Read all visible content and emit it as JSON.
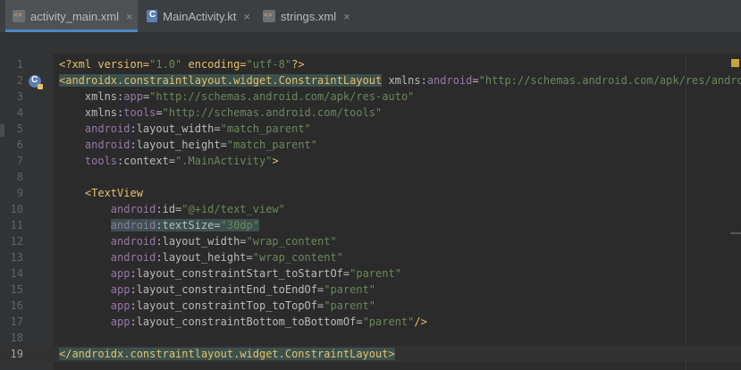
{
  "tabs": [
    {
      "label": "activity_main.xml",
      "icon": "xml-file-icon",
      "active": true
    },
    {
      "label": "MainActivity.kt",
      "icon": "kotlin-class-icon",
      "active": false
    },
    {
      "label": "strings.xml",
      "icon": "xml-file-icon",
      "active": false
    }
  ],
  "close_glyph": "×",
  "line_numbers": [
    "1",
    "2",
    "3",
    "4",
    "5",
    "6",
    "7",
    "8",
    "9",
    "10",
    "11",
    "12",
    "13",
    "14",
    "15",
    "16",
    "17",
    "18",
    "19"
  ],
  "code": {
    "l1": {
      "decl": "<?xml version=",
      "v1": "\"1.0\"",
      "enc": " encoding=",
      "v2": "\"utf-8\"",
      "end": "?>"
    },
    "l2": {
      "open": "<androidx.constraintlayout.widget.ConstraintLayout",
      "xmlns": " xmlns:",
      "ns": "android",
      "eq": "=",
      "val": "\"http://schemas.android.com/apk/res/android\""
    },
    "l3": {
      "indent": "    ",
      "xmlns": "xmlns:",
      "ns": "app",
      "eq": "=",
      "val": "\"http://schemas.android.com/apk/res-auto\""
    },
    "l4": {
      "indent": "    ",
      "xmlns": "xmlns:",
      "ns": "tools",
      "eq": "=",
      "val": "\"http://schemas.android.com/tools\""
    },
    "l5": {
      "indent": "    ",
      "ns": "android",
      "attr": ":layout_width=",
      "val": "\"match_parent\""
    },
    "l6": {
      "indent": "    ",
      "ns": "android",
      "attr": ":layout_height=",
      "val": "\"match_parent\""
    },
    "l7": {
      "indent": "    ",
      "ns": "tools",
      "attr": ":context=",
      "val": "\".MainActivity\"",
      "close": ">"
    },
    "l9": {
      "indent": "    ",
      "tag": "<TextView"
    },
    "l10": {
      "indent": "        ",
      "ns": "android",
      "attr": ":id=",
      "val": "\"@+id/text_view\""
    },
    "l11": {
      "indent": "        ",
      "ns": "android",
      "attr": ":textSize=",
      "val": "\"30dp\""
    },
    "l12": {
      "indent": "        ",
      "ns": "android",
      "attr": ":layout_width=",
      "val": "\"wrap_content\""
    },
    "l13": {
      "indent": "        ",
      "ns": "android",
      "attr": ":layout_height=",
      "val": "\"wrap_content\""
    },
    "l14": {
      "indent": "        ",
      "ns": "app",
      "attr": ":layout_constraintStart_toStartOf=",
      "val": "\"parent\""
    },
    "l15": {
      "indent": "        ",
      "ns": "app",
      "attr": ":layout_constraintEnd_toEndOf=",
      "val": "\"parent\""
    },
    "l16": {
      "indent": "        ",
      "ns": "app",
      "attr": ":layout_constraintTop_toTopOf=",
      "val": "\"parent\""
    },
    "l17": {
      "indent": "        ",
      "ns": "app",
      "attr": ":layout_constraintBottom_toBottomOf=",
      "val": "\"parent\"",
      "close": "/>"
    },
    "l19": {
      "tag": "</androidx.constraintlayout.widget.ConstraintLayout>"
    }
  },
  "colors": {
    "tag": "#e8bf6a",
    "namespace": "#9876aa",
    "string": "#6a8759",
    "attribute": "#bababa",
    "background": "#2b2b2b",
    "gutter": "#313335"
  }
}
